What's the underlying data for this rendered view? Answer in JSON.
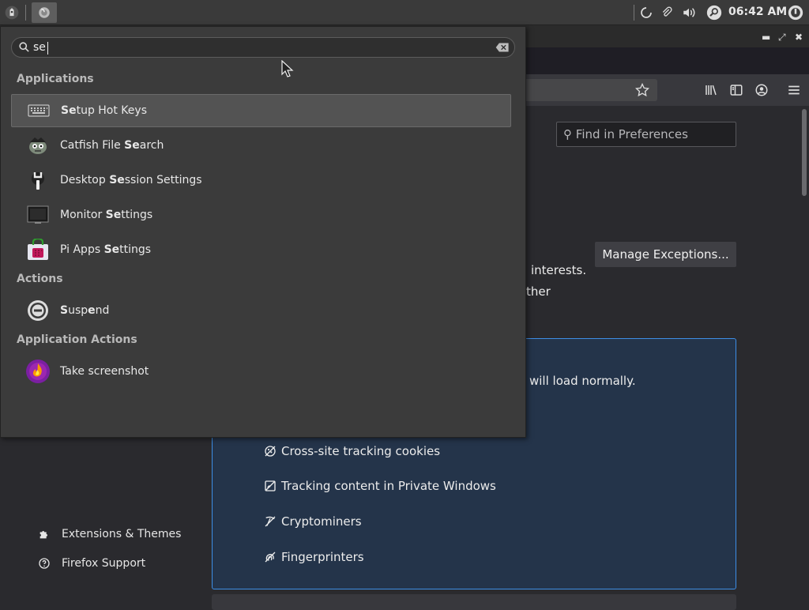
{
  "panel": {
    "clock": "06:42 AM",
    "icons": [
      "menu-icon",
      "firefox-icon",
      "loading-icon",
      "paperclip-icon",
      "volume-icon",
      "search-icon",
      "power-icon"
    ]
  },
  "firefox": {
    "find_placeholder": "Find in Preferences",
    "manage_exceptions": "Manage Exceptions...",
    "frag_interests": "interests.",
    "frag_ther": "ther",
    "frag_load": "will load normally.",
    "blocked_items": [
      {
        "label": "Cross-site tracking cookies",
        "icon": "cookie-icon"
      },
      {
        "label": "Tracking content in Private Windows",
        "icon": "tracking-content-icon"
      },
      {
        "label": "Cryptominers",
        "icon": "cryptominer-icon"
      },
      {
        "label": "Fingerprinters",
        "icon": "fingerprinter-icon"
      }
    ],
    "sidebar": {
      "extensions": "Extensions & Themes",
      "support": "Firefox Support"
    }
  },
  "menu": {
    "search_value": "se",
    "sections": {
      "applications": "Applications",
      "actions": "Actions",
      "app_actions": "Application Actions"
    },
    "applications": [
      {
        "pre": "",
        "bold": "Se",
        "post": "tup Hot Keys",
        "icon": "keyboard-icon"
      },
      {
        "pre": "Catfish File ",
        "bold": "Se",
        "post": "arch",
        "icon": "catfish-icon"
      },
      {
        "pre": "Desktop ",
        "bold": "Se",
        "post": "ssion Settings",
        "icon": "session-settings-icon"
      },
      {
        "pre": "Monitor ",
        "bold": "Se",
        "post": "ttings",
        "icon": "monitor-icon"
      },
      {
        "pre": "Pi Apps ",
        "bold": "Se",
        "post": "ttings",
        "icon": "pi-apps-icon"
      }
    ],
    "actions": [
      {
        "s": "S",
        "mid": "usp",
        "e": "e",
        "end": "nd",
        "icon": "suspend-icon"
      }
    ],
    "app_actions": [
      {
        "label": "Take screenshot",
        "icon": "screenshot-icon"
      }
    ]
  },
  "colors": {
    "accent_blue": "#3d8ee6",
    "panel_bg": "#3a3a3a",
    "menu_bg": "#3b3b3b"
  }
}
